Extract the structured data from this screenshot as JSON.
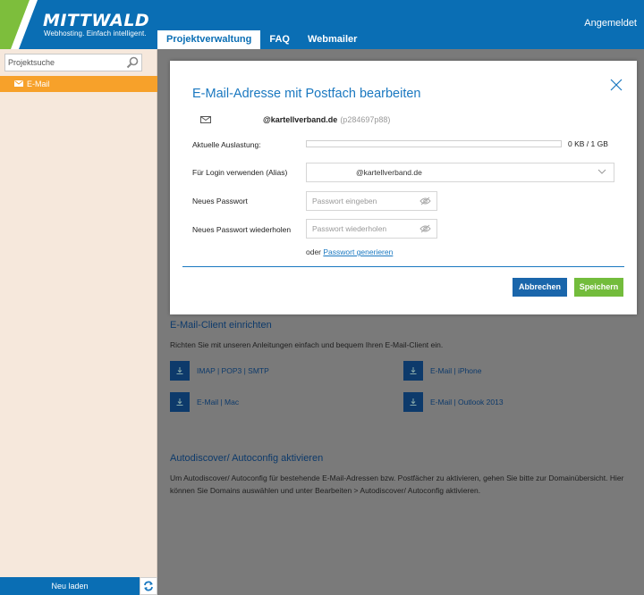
{
  "header": {
    "logo_text": "MITTWALD",
    "logo_sub": "Webhosting. Einfach intelligent.",
    "status": "Angemeldet",
    "tabs": [
      {
        "label": "Projektverwaltung"
      },
      {
        "label": "FAQ"
      },
      {
        "label": "Webmailer"
      }
    ]
  },
  "sidebar": {
    "search_placeholder": "Projektsuche",
    "item_label": "E-Mail",
    "reload_label": "Neu laden"
  },
  "main": {
    "client_title": "E-Mail-Client einrichten",
    "client_text": "Richten Sie mit unseren Anleitungen einfach und bequem Ihren E-Mail-Client ein.",
    "downloads": [
      {
        "label": "IMAP | POP3 | SMTP"
      },
      {
        "label": "E-Mail | iPhone"
      },
      {
        "label": "E-Mail | Mac"
      },
      {
        "label": "E-Mail | Outlook 2013"
      }
    ],
    "autodiscover_title": "Autodiscover/ Autoconfig aktivieren",
    "autodiscover_text": "Um Autodiscover/ Autoconfig für bestehende E-Mail-Adressen bzw. Postfächer zu aktivieren, gehen Sie bitte zur Domainübersicht. Hier können Sie Domains auswählen und unter Bearbeiten > Autodiscover/ Autoconfig aktivieren."
  },
  "modal": {
    "title": "E-Mail-Adresse mit Postfach bearbeiten",
    "address_domain": "@kartellverband.de",
    "address_id": "(p284697p88)",
    "usage_label": "Aktuelle Auslastung:",
    "usage_value": "0 KB / 1 GB",
    "usage_fraction": 0,
    "alias_label": "Für Login verwenden (Alias)",
    "alias_value": "@kartellverband.de",
    "pw_label": "Neues Passwort",
    "pw_placeholder": "Passwort eingeben",
    "pw2_label": "Neues Passwort wiederholen",
    "pw2_placeholder": "Passwort wiederholen",
    "gen_prefix": "oder",
    "gen_link": "Passwort generieren",
    "cancel_label": "Abbrechen",
    "save_label": "Speichern"
  },
  "colors": {
    "brand_blue": "#0a6eb4",
    "brand_green": "#7dbe3c",
    "sidebar_active": "#f7a12a",
    "save_green": "#73bc3c"
  }
}
